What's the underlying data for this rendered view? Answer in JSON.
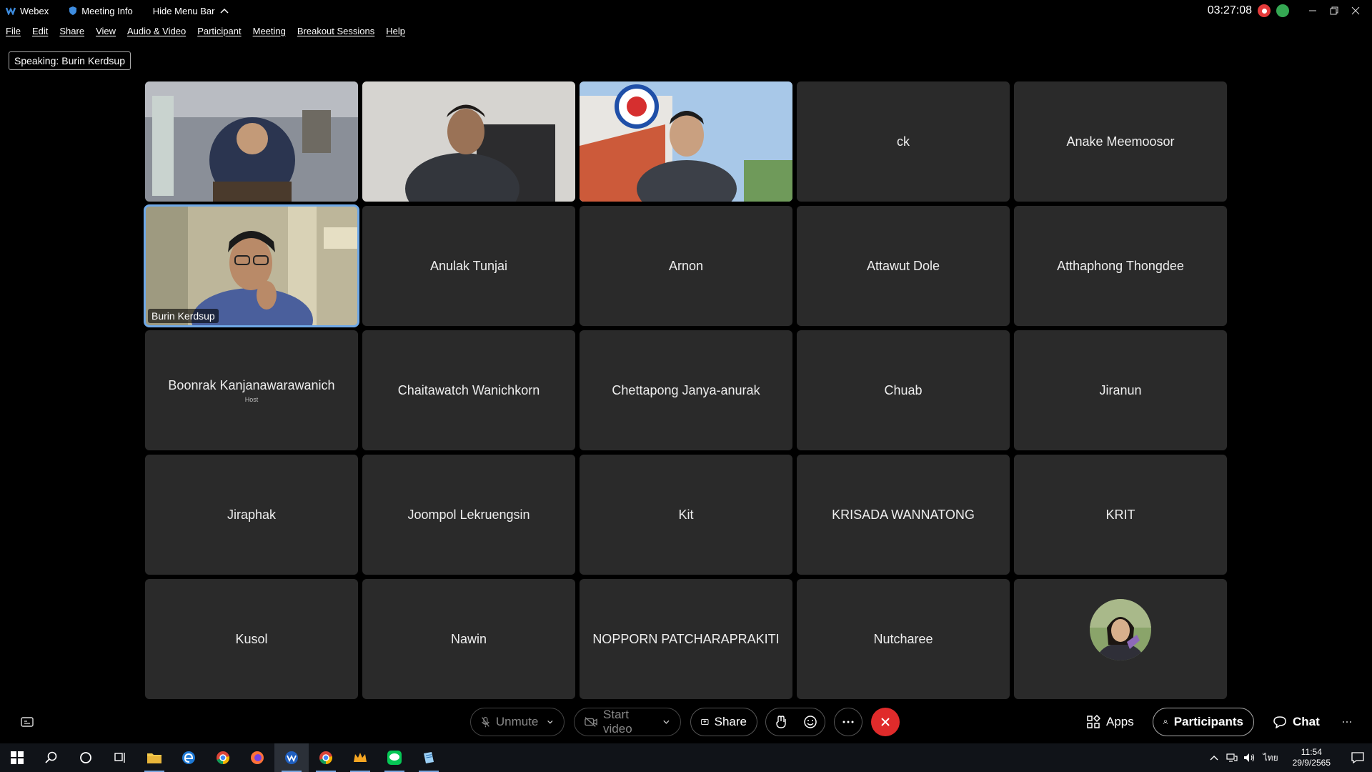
{
  "titlebar": {
    "app_name": "Webex",
    "meeting_info": "Meeting Info",
    "hide_menu": "Hide Menu Bar",
    "clock": "03:27:08"
  },
  "menu": [
    "File",
    "Edit",
    "Share",
    "View",
    "Audio & Video",
    "Participant",
    "Meeting",
    "Breakout Sessions",
    "Help"
  ],
  "speaking": {
    "label": "Speaking:",
    "name": "Burin Kerdsup"
  },
  "participants": [
    {
      "name": "",
      "video": true
    },
    {
      "name": "",
      "video": true
    },
    {
      "name": "",
      "video": true
    },
    {
      "name": "ck",
      "video": false
    },
    {
      "name": "Anake Meemoosor",
      "video": false
    },
    {
      "name": "Burin Kerdsup",
      "video": true,
      "active": true
    },
    {
      "name": "Anulak Tunjai",
      "video": false
    },
    {
      "name": "Arnon",
      "video": false
    },
    {
      "name": "Attawut Dole",
      "video": false
    },
    {
      "name": "Atthaphong Thongdee",
      "video": false
    },
    {
      "name": "Boonrak Kanjanawarawanich",
      "role": "Host",
      "video": false
    },
    {
      "name": "Chaitawatch Wanichkorn",
      "video": false
    },
    {
      "name": "Chettapong Janya-anurak",
      "video": false
    },
    {
      "name": "Chuab",
      "video": false
    },
    {
      "name": "Jiranun",
      "video": false
    },
    {
      "name": "Jiraphak",
      "video": false
    },
    {
      "name": "Joompol Lekruengsin",
      "video": false
    },
    {
      "name": "Kit",
      "video": false
    },
    {
      "name": "KRISADA WANNATONG",
      "video": false
    },
    {
      "name": "KRIT",
      "video": false
    },
    {
      "name": "Kusol",
      "video": false
    },
    {
      "name": "Nawin",
      "video": false
    },
    {
      "name": "NOPPORN PATCHARAPRAKITI",
      "video": false
    },
    {
      "name": "Nutcharee",
      "video": false
    },
    {
      "name": "",
      "avatar": true,
      "video": false
    }
  ],
  "controls": {
    "unmute": "Unmute",
    "start_video": "Start video",
    "share": "Share",
    "apps": "Apps",
    "participants": "Participants",
    "chat": "Chat"
  },
  "taskbar": {
    "time": "11:54",
    "date": "29/9/2565",
    "lang": "ไทย"
  },
  "colors": {
    "tile_bg": "#2a2a2a",
    "active_border": "#6fa8e6",
    "end_button": "#e02b2b"
  }
}
